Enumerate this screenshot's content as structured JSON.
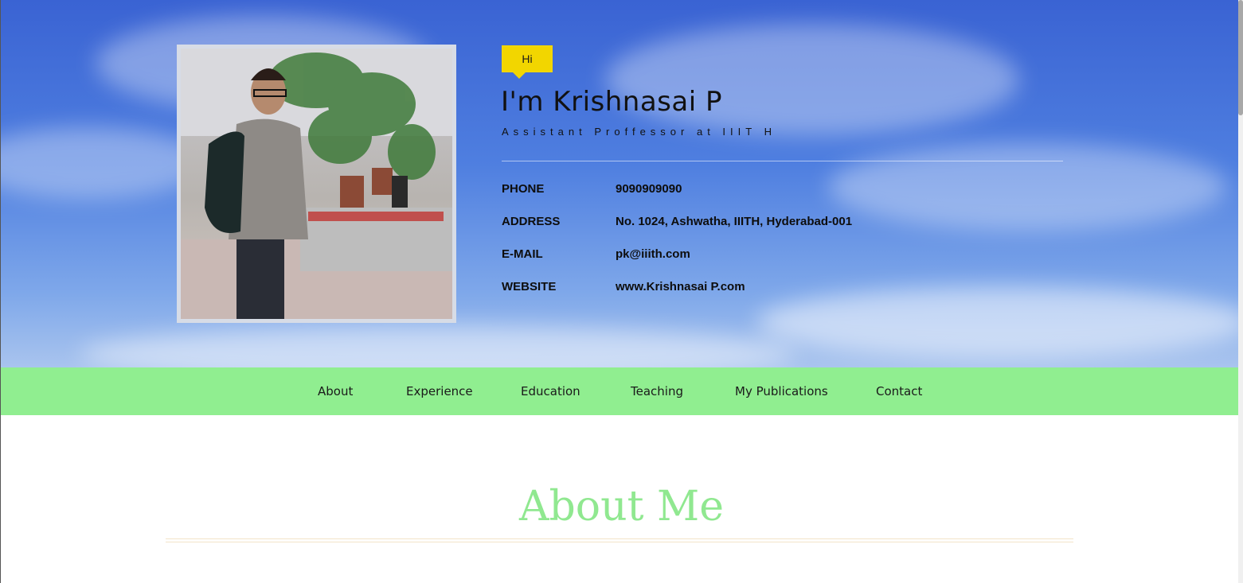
{
  "hero": {
    "badge": "Hi",
    "name": "I'm Krishnasai P",
    "subtitle": "Assistant Proffessor at IIIT H",
    "info": [
      {
        "label": "PHONE",
        "value": "9090909090"
      },
      {
        "label": "ADDRESS",
        "value": "No. 1024, Ashwatha, IIITH, Hyderabad-001"
      },
      {
        "label": "E-MAIL",
        "value": "pk@iiith.com"
      },
      {
        "label": "WEBSITE",
        "value": "www.Krishnasai P.com"
      }
    ]
  },
  "nav": {
    "items": [
      "About",
      "Experience",
      "Education",
      "Teaching",
      "My Publications",
      "Contact"
    ]
  },
  "about": {
    "title": "About Me"
  },
  "colors": {
    "nav_bg": "#90ee90",
    "badge_bg": "#f2d600",
    "about_title": "#90e890"
  }
}
